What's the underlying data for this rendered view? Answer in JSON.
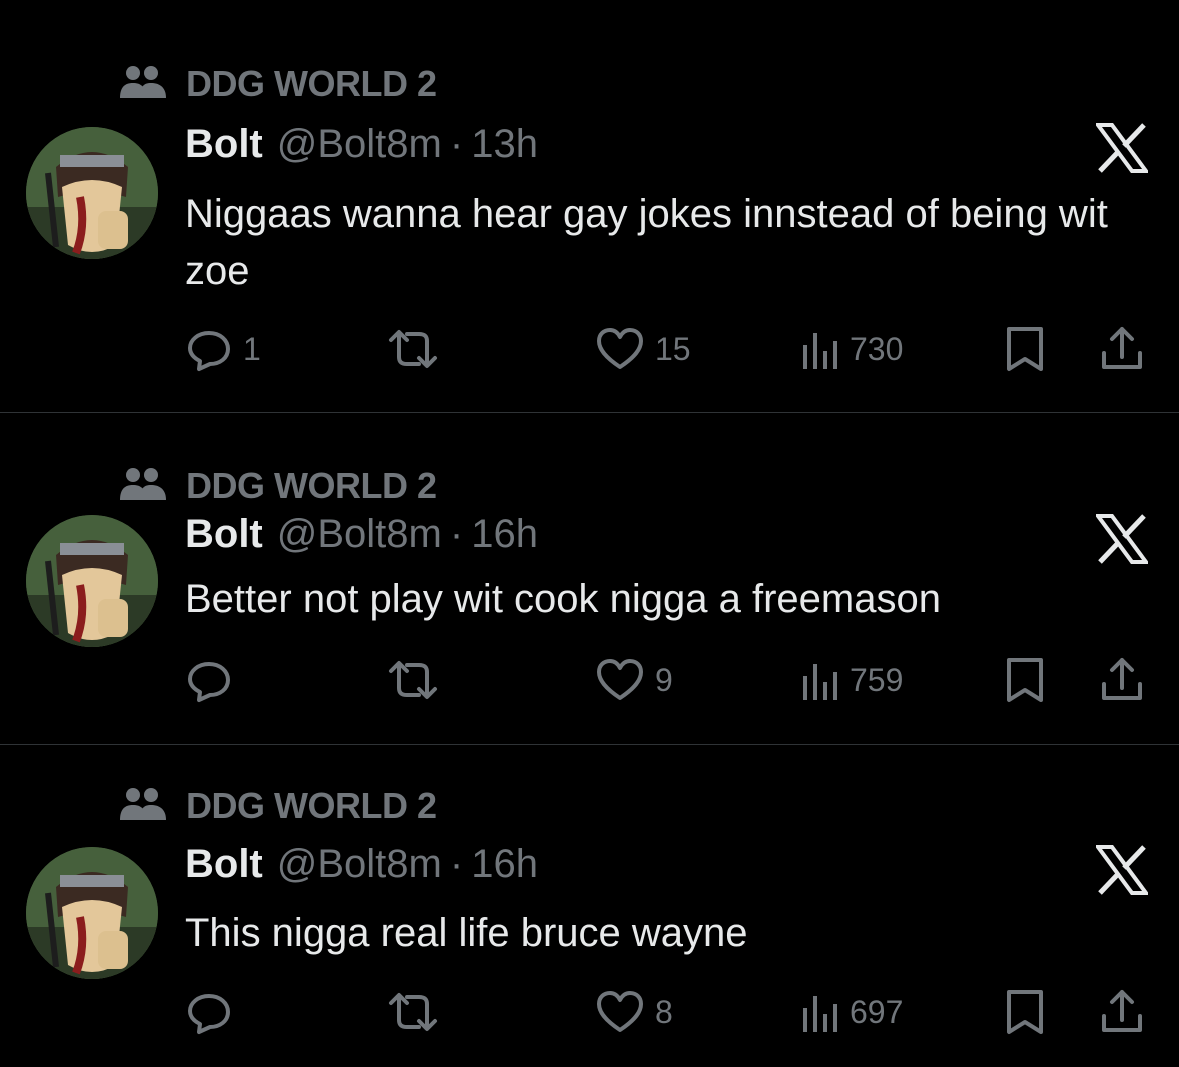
{
  "tweets": [
    {
      "community": "DDG WORLD 2",
      "name": "Bolt",
      "handle": "@Bolt8m",
      "dot": "·",
      "time": "13h",
      "text": "Niggaas wanna hear gay jokes innstead of being wit zoe",
      "replies": "1",
      "likes": "15",
      "views": "730"
    },
    {
      "community": "DDG WORLD 2",
      "name": "Bolt",
      "handle": "@Bolt8m",
      "dot": "·",
      "time": "16h",
      "text": "Better not play wit cook nigga a freemason",
      "replies": "",
      "likes": "9",
      "views": "759"
    },
    {
      "community": "DDG WORLD 2",
      "name": "Bolt",
      "handle": "@Bolt8m",
      "dot": "·",
      "time": "16h",
      "text": "This nigga real life bruce wayne",
      "replies": "",
      "likes": "8",
      "views": "697"
    }
  ],
  "icons": {
    "community": "community-icon",
    "reply": "reply-icon",
    "retweet": "retweet-icon",
    "like": "heart-icon",
    "views": "views-icon",
    "bookmark": "bookmark-icon",
    "share": "share-icon",
    "brand": "x-logo-icon"
  },
  "colors": {
    "background": "#000000",
    "text_primary": "#e7e9ea",
    "text_secondary": "#71767b",
    "divider": "#2f3336"
  }
}
